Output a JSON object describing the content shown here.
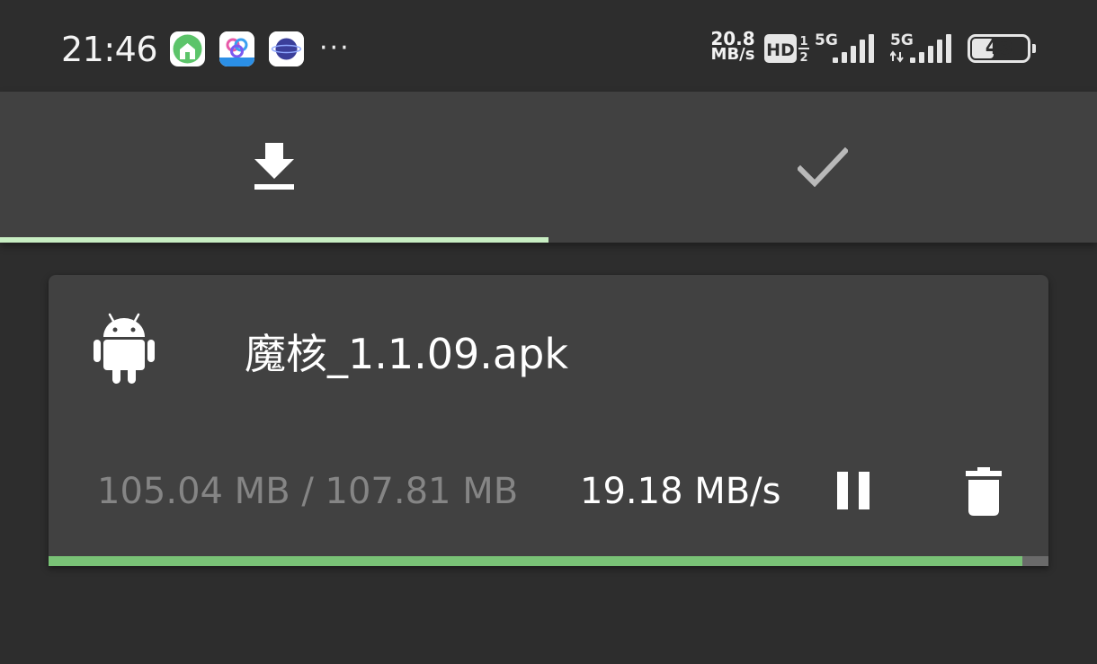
{
  "status_bar": {
    "time": "21:46",
    "notification_icons": [
      {
        "name": "green-house-app-icon",
        "color": "#5cc46a"
      },
      {
        "name": "genflow-app-icon",
        "label": "GenFlow",
        "color": "#2b8fe6"
      },
      {
        "name": "blue-planet-app-icon",
        "color": "#3b3f9a"
      }
    ],
    "overflow": "···",
    "network_speed_value": "20.8",
    "network_speed_unit": "MB/s",
    "hd_label": "HD",
    "hd_sup": "1",
    "hd_sub": "2",
    "sim1_label": "5G",
    "sim2_label": "5G",
    "battery": "43",
    "battery_level": 0.43
  },
  "tabs": [
    {
      "id": "downloading",
      "icon": "download-icon",
      "active": true
    },
    {
      "id": "completed",
      "icon": "checkmark-icon",
      "active": false
    }
  ],
  "download": {
    "file_icon": "android-icon",
    "file_name": "魔核_1.1.09.apk",
    "size_progress": "105.04 MB / 107.81 MB",
    "speed": "19.18 MB/s",
    "progress": 0.9743,
    "pause_icon": "pause-icon",
    "delete_icon": "trash-icon"
  },
  "colors": {
    "background": "#2d2d2d",
    "surface": "#414141",
    "tab_indicator": "#c8eec3",
    "progress_fill": "#79c276",
    "progress_track": "#6a6a6a",
    "secondary_text": "#858585"
  }
}
